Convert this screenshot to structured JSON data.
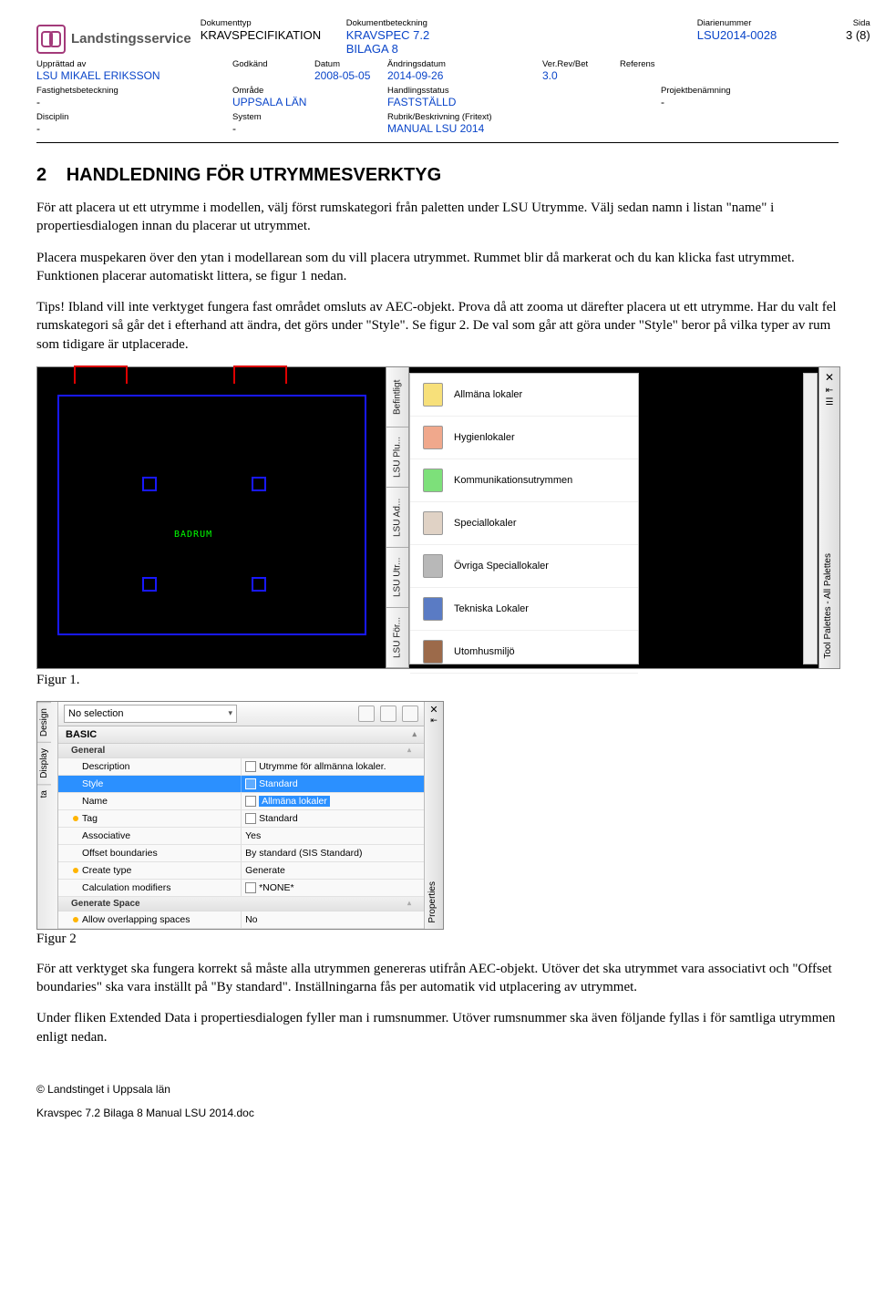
{
  "logo_text": "Landstingsservice",
  "header": {
    "doktyp_l": "Dokumenttyp",
    "doktyp_v": "KRAVSPECIFIKATION",
    "dokbet_l": "Dokumentbeteckning",
    "dokbet_v": "KRAVSPEC 7.2 BILAGA 8",
    "dianr_l": "Diarienummer",
    "dianr_v": "LSU2014-0028",
    "sida_l": "Sida",
    "sida_v": "3 (8)",
    "uppr_l": "Upprättad av",
    "uppr_v": "LSU MIKAEL ERIKSSON",
    "godk_l": "Godkänd",
    "godk_v": "",
    "datum_l": "Datum",
    "datum_v": "2008-05-05",
    "andr_l": "Ändringsdatum",
    "andr_v": "2014-09-26",
    "ver_l": "Ver.Rev/Bet",
    "ver_v": "3.0",
    "ref_l": "Referens",
    "ref_v": ""
  },
  "lower": {
    "fast_l": "Fastighetsbeteckning",
    "fast_v": "-",
    "omr_l": "Område",
    "omr_v": "UPPSALA LÄN",
    "hand_l": "Handlingsstatus",
    "hand_v": "FASTSTÄLLD",
    "proj_l": "Projektbenämning",
    "proj_v": "-",
    "disc_l": "Disciplin",
    "disc_v": "-",
    "sys_l": "System",
    "sys_v": "-",
    "rubr_l": "Rubrik/Beskrivning (Fritext)",
    "rubr_v": "MANUAL LSU 2014"
  },
  "section_num": "2",
  "section_title": "HANDLEDNING FÖR UTRYMMESVERKTYG",
  "p1": "För att placera ut ett utrymme i modellen, välj först rumskategori från paletten under LSU Utrymme. Välj sedan namn i listan \"name\" i propertiesdialogen innan du placerar ut utrymmet.",
  "p2": "Placera muspekaren över den ytan i modellarean som du vill placera utrymmet. Rummet blir då markerat och du kan klicka fast utrymmet. Funktionen placerar automatiskt littera, se figur 1 nedan.",
  "p3": "Tips! Ibland vill inte verktyget fungera fast området omsluts av AEC-objekt. Prova då att zooma ut därefter placera ut ett utrymme. Har du valt fel rumskategori så går det i efterhand att ändra, det görs under \"Style\". Se figur 2. De val som går att göra under \"Style\" beror på vilka typer av rum som tidigare är utplacerade.",
  "fig1_caption": "Figur 1.",
  "fig2_caption": "Figur 2",
  "p4": "För att verktyget ska fungera korrekt så måste alla utrymmen genereras utifrån AEC-objekt. Utöver det ska utrymmet vara associativt och \"Offset boundaries\" ska vara inställt på \"By standard\". Inställningarna fås per automatik vid utplacering av utrymmet.",
  "p5": "Under fliken Extended Data i propertiesdialogen fyller man i rumsnummer. Utöver rumsnummer ska även följande fyllas i för samtliga utrymmen enligt nedan.",
  "cad_label": "BADRUM",
  "tabs": [
    "Befintligt",
    "LSU Plu...",
    "LSU Ad...",
    "LSU Utr...",
    "LSU För..."
  ],
  "palette_title": "Tool Palettes - All Palettes",
  "palette": [
    {
      "color": "#f7e07a",
      "label": "Allmäna lokaler"
    },
    {
      "color": "#f0a88c",
      "label": "Hygienlokaler"
    },
    {
      "color": "#7de07a",
      "label": "Kommunikationsutrymmen"
    },
    {
      "color": "#e0d2c5",
      "label": "Speciallokaler"
    },
    {
      "color": "#b8b8b8",
      "label": "Övriga Speciallokaler"
    },
    {
      "color": "#5a7bc4",
      "label": "Tekniska Lokaler"
    },
    {
      "color": "#9c6a4a",
      "label": "Utomhusmiljö"
    }
  ],
  "fig2": {
    "no_selection": "No selection",
    "left_tabs": [
      "Design",
      "Display",
      "ta"
    ],
    "right_label": "Properties",
    "cat_basic": "BASIC",
    "sub_general": "General",
    "sub_genspace": "Generate Space",
    "rows": [
      {
        "k": "Description",
        "v": "Utrymme för allmänna lokaler.",
        "marked": false,
        "sel": false,
        "ico": true
      },
      {
        "k": "Style",
        "v": "Standard",
        "marked": false,
        "sel": true,
        "ico": true
      },
      {
        "k": "Name",
        "v": "Allmäna lokaler",
        "marked": false,
        "sel": false,
        "ico": true,
        "hlv": true
      },
      {
        "k": "Tag",
        "v": "Standard",
        "marked": true,
        "sel": false,
        "ico": true
      },
      {
        "k": "Associative",
        "v": "Yes",
        "marked": false,
        "sel": false,
        "ico": false
      },
      {
        "k": "Offset boundaries",
        "v": "By standard (SIS Standard)",
        "marked": false,
        "sel": false,
        "ico": false
      },
      {
        "k": "Create type",
        "v": "Generate",
        "marked": true,
        "sel": false,
        "ico": false
      },
      {
        "k": "Calculation modifiers",
        "v": "*NONE*",
        "marked": false,
        "sel": false,
        "ico": true
      }
    ],
    "overlap": {
      "k": "Allow overlapping spaces",
      "v": "No"
    }
  },
  "footer_copy": "© Landstinget i Uppsala län",
  "footer_doc": "Kravspec 7.2 Bilaga 8 Manual LSU 2014.doc"
}
